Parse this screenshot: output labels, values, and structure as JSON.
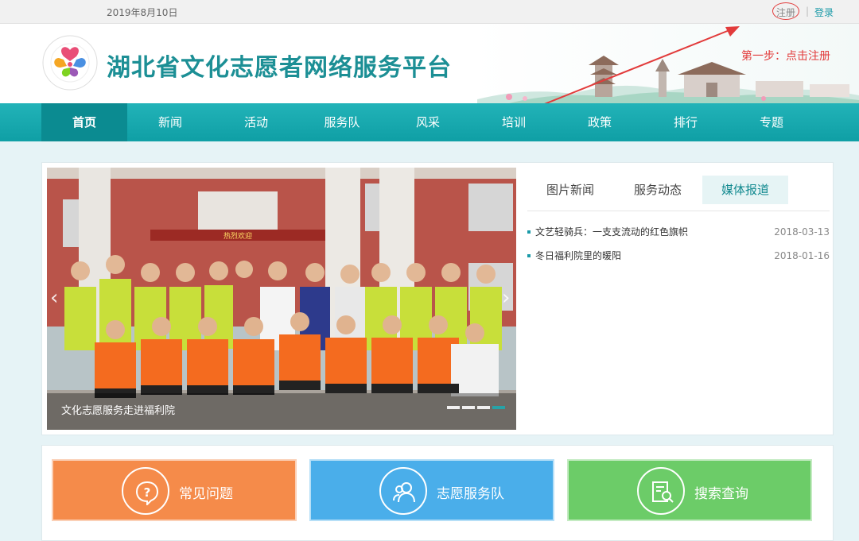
{
  "topbar": {
    "date": "2019年8月10日",
    "register": "注册",
    "separator": "|",
    "login": "登录"
  },
  "header": {
    "title": "湖北省文化志愿者网络服务平台",
    "annotation": "第一步：点击注册"
  },
  "nav": {
    "items": [
      {
        "label": "首页",
        "active": true
      },
      {
        "label": "新闻"
      },
      {
        "label": "活动"
      },
      {
        "label": "服务队"
      },
      {
        "label": "风采"
      },
      {
        "label": "培训"
      },
      {
        "label": "政策"
      },
      {
        "label": "排行"
      },
      {
        "label": "专题"
      }
    ]
  },
  "slider": {
    "caption": "文化志愿服务走进福利院",
    "prev_icon": "chevron-left-icon",
    "next_icon": "chevron-right-icon",
    "slide_count": 4,
    "active_slide": 4,
    "banner_text": "热烈欢迎"
  },
  "tabs": [
    {
      "label": "图片新闻"
    },
    {
      "label": "服务动态"
    },
    {
      "label": "媒体报道",
      "active": true
    }
  ],
  "news": [
    {
      "title": "文艺轻骑兵：一支支流动的红色旗帜",
      "date": "2018-03-13"
    },
    {
      "title": "冬日福利院里的暖阳",
      "date": "2018-01-16"
    }
  ],
  "quick_links": [
    {
      "label": "常见问题",
      "icon": "question-bubble-icon",
      "color": "#f58b4a"
    },
    {
      "label": "志愿服务队",
      "icon": "people-icon",
      "color": "#4aaeea"
    },
    {
      "label": "搜索查询",
      "icon": "document-search-icon",
      "color": "#6ccc68"
    }
  ],
  "colors": {
    "brand": "#1c8f95",
    "nav": "#15a8ae",
    "annotation": "#e23b3b"
  }
}
